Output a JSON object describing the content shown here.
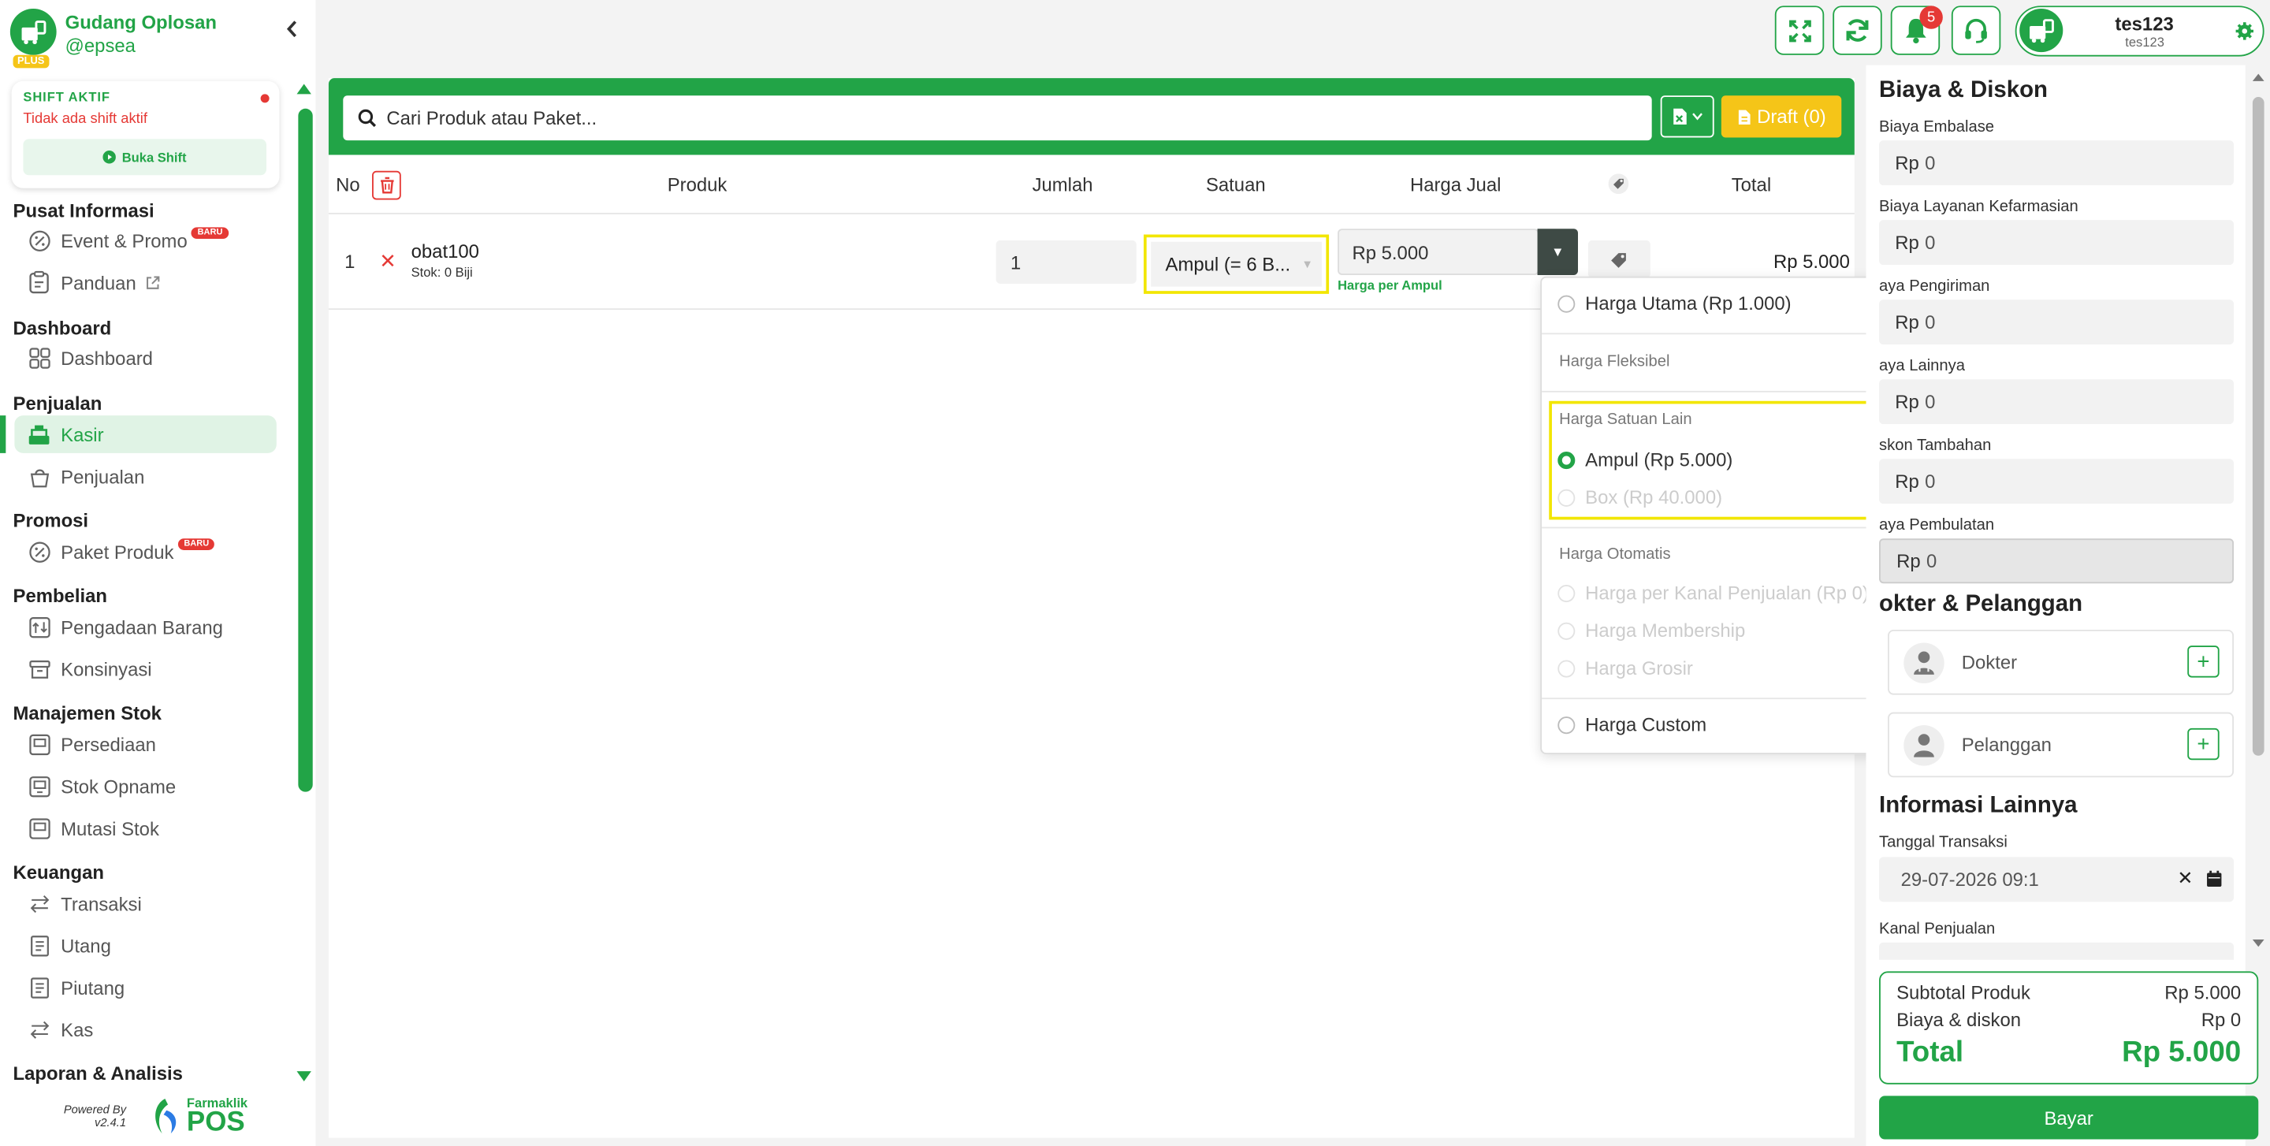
{
  "brand": {
    "name": "Gudang Oplosan",
    "username": "@epsea",
    "plan_badge": "PLUS",
    "collapse_icon": "chevron-left-icon"
  },
  "shift": {
    "title": "SHIFT AKTIF",
    "status": "Tidak ada shift aktif",
    "button": "Buka Shift"
  },
  "menu": {
    "sections": [
      "Pusat Informasi",
      "Dashboard",
      "Penjualan",
      "Promosi",
      "Pembelian",
      "Manajemen Stok",
      "Keuangan",
      "Laporan & Analisis"
    ],
    "items": [
      {
        "label": "Event & Promo",
        "badge": "BARU",
        "icon": "percent-icon"
      },
      {
        "label": "Panduan",
        "icon": "clipboard-icon",
        "external": "external-link-icon"
      },
      {
        "label": "Dashboard",
        "icon": "grid-icon"
      },
      {
        "label": "Kasir",
        "icon": "cash-register-icon",
        "active": true
      },
      {
        "label": "Penjualan",
        "icon": "basket-icon"
      },
      {
        "label": "Paket Produk",
        "badge": "BARU",
        "icon": "percent-icon"
      },
      {
        "label": "Pengadaan Barang",
        "icon": "procurement-icon"
      },
      {
        "label": "Konsinyasi",
        "icon": "box-icon"
      },
      {
        "label": "Persediaan",
        "icon": "inventory-icon"
      },
      {
        "label": "Stok Opname",
        "icon": "stock-opname-icon"
      },
      {
        "label": "Mutasi Stok",
        "icon": "stock-mutation-icon"
      },
      {
        "label": "Transaksi",
        "icon": "transfer-icon"
      },
      {
        "label": "Utang",
        "icon": "ledger-icon"
      },
      {
        "label": "Piutang",
        "icon": "ledger-icon"
      },
      {
        "label": "Kas",
        "icon": "cash-icon"
      }
    ]
  },
  "footer": {
    "powered": "Powered By",
    "version": "v2.4.1",
    "logo_small": "Farmaklik",
    "logo_big": "POS"
  },
  "topbar": {
    "notification_count": "5",
    "user_name": "tes123",
    "user_sub": "tes123",
    "icons": [
      "fullscreen-icon",
      "refresh-icon",
      "bell-icon",
      "headset-icon",
      "settings-icon"
    ]
  },
  "search": {
    "placeholder": "Cari Produk atau Paket...",
    "draft_label": "Draft (0)"
  },
  "table": {
    "headers": {
      "no": "No",
      "product": "Produk",
      "qty": "Jumlah",
      "unit": "Satuan",
      "price": "Harga Jual",
      "total": "Total"
    },
    "rows": [
      {
        "no": "1",
        "name": "obat100",
        "stock": "Stok: 0 Biji",
        "qty": "1",
        "unit": "Ampul (= 6 B...",
        "price": "Rp 5.000",
        "price_note": "Harga per Ampul",
        "total": "Rp 5.000"
      }
    ]
  },
  "price_dropdown": {
    "main": "Harga Utama (Rp 1.000)",
    "group_flex": "Harga Fleksibel",
    "group_units": "Harga Satuan Lain",
    "unit_options": [
      {
        "label": "Ampul (Rp 5.000)",
        "selected": true
      },
      {
        "label": "Box (Rp 40.000)",
        "disabled": true
      }
    ],
    "group_auto": "Harga Otomatis",
    "auto_options": [
      "Harga per Kanal Penjualan (Rp 0)",
      "Harga Membership",
      "Harga Grosir"
    ],
    "custom": "Harga Custom"
  },
  "right_panel": {
    "costs_title": "Biaya & Diskon",
    "costs": [
      {
        "label": "Biaya Embalase",
        "value": "0"
      },
      {
        "label": "Biaya Layanan Kefarmasian",
        "value": "0"
      },
      {
        "label": "aya Pengiriman",
        "value": "0"
      },
      {
        "label": "aya Lainnya",
        "value": "0"
      },
      {
        "label": "skon Tambahan",
        "value": "0"
      },
      {
        "label": "aya Pembulatan",
        "value": "0"
      }
    ],
    "currency": "Rp",
    "parties_title": "okter & Pelanggan",
    "doctor": "Dokter",
    "customer": "Pelanggan",
    "info_title": "Informasi Lainnya",
    "date_label": "Tanggal Transaksi",
    "date_value": "29-07-2026 09:1",
    "channel_label": "Kanal Penjualan"
  },
  "summary": {
    "subtotal_label": "Subtotal Produk",
    "subtotal": "Rp 5.000",
    "fees_label": "Biaya & diskon",
    "fees": "Rp 0",
    "total_label": "Total",
    "total": "Rp 5.000",
    "pay": "Bayar"
  },
  "colors": {
    "primary": "#22a447",
    "danger": "#e53935",
    "draft": "#f5c518",
    "highlight": "#f2e600"
  }
}
